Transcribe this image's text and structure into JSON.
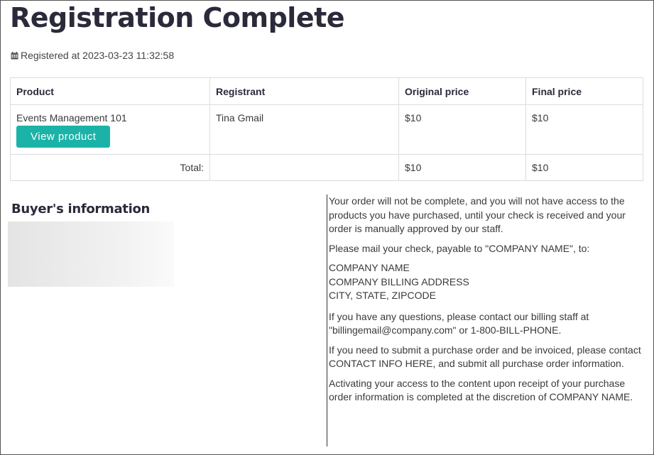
{
  "page": {
    "title": "Registration Complete",
    "registered_text": "Registered at 2023-03-23 11:32:58"
  },
  "table": {
    "headers": {
      "product": "Product",
      "registrant": "Registrant",
      "original_price": "Original price",
      "final_price": "Final price"
    },
    "rows": [
      {
        "product": "Events Management 101",
        "view_button": "View product",
        "registrant": "Tina Gmail",
        "original_price": "$10",
        "final_price": "$10"
      }
    ],
    "total": {
      "label": "Total:",
      "registrant": "",
      "original_price": "$10",
      "final_price": "$10"
    }
  },
  "buyer": {
    "heading": "Buyer's information"
  },
  "instructions": {
    "p1": "Your order will not be complete, and you will not have access to the products you have purchased, until your check is received and your order is manually approved by our staff.",
    "p2": "Please mail your check, payable to \"COMPANY NAME\", to:",
    "address": [
      "COMPANY NAME",
      "COMPANY BILLING ADDRESS",
      "CITY, STATE, ZIPCODE"
    ],
    "p3": "If you have any questions, please contact our billing staff at \"billingemail@company.com\" or 1-800-BILL-PHONE.",
    "p4": "If you need to submit a purchase order and be invoiced, please contact CONTACT INFO HERE, and submit all purchase order information.",
    "p5": "Activating your access to the content upon receipt of your purchase order information is completed at the discretion of COMPANY NAME."
  },
  "icons": {
    "calendar": "calendar-icon"
  },
  "colors": {
    "button": "#1bb3a8",
    "title": "#2a2a3a"
  }
}
